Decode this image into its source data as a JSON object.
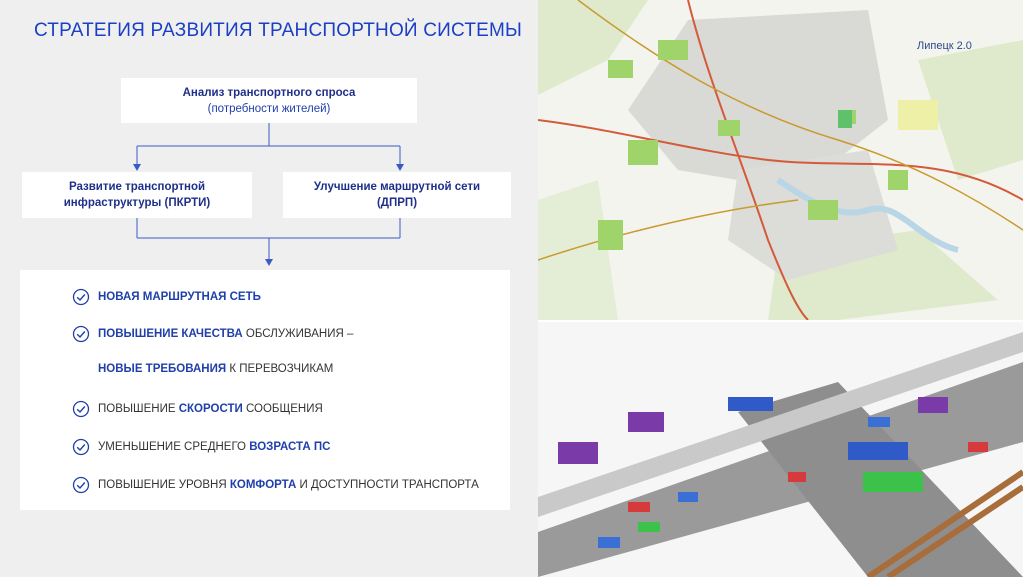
{
  "slide": {
    "title": "СТРАТЕГИЯ РАЗВИТИЯ ТРАНСПОРТНОЙ СИСТЕМЫ",
    "top_box": {
      "bold": "Анализ транспортного спроса",
      "sub": "(потребности жителей)"
    },
    "left_box": {
      "line1": "Развитие транспортной",
      "line2": "инфраструктуры (ПКРТИ)"
    },
    "right_box": {
      "line1": "Улучшение маршрутной сети",
      "line2": "(ДПРП)"
    },
    "items": [
      {
        "hl": "НОВАЯ МАРШРУТНАЯ СЕТЬ"
      },
      {
        "hl": "ПОВЫШЕНИЕ КАЧЕСТВА",
        "rest": " ОБСЛУЖИВАНИЯ –"
      },
      {
        "hl": "НОВЫЕ ТРЕБОВАНИЯ",
        "rest": " К ПЕРЕВОЗЧИКАМ"
      },
      {
        "pre": "ПОВЫШЕНИЕ ",
        "hl": "СКОРОСТИ",
        "rest": " СООБЩЕНИЯ"
      },
      {
        "pre": "УМЕНЬШЕНИЕ СРЕДНЕГО ",
        "hl": "ВОЗРАСТА ПС"
      },
      {
        "pre": "ПОВЫШЕНИЕ УРОВНЯ ",
        "hl": "КОМФОРТА",
        "rest": " И ДОСТУПНОСТИ ТРАНСПОРТА"
      }
    ],
    "map_label": "Липецк 2.0",
    "colors": {
      "accent": "#1a3fc4",
      "check": "#1f3faa",
      "connector": "#3a5bc7"
    },
    "icons": [
      "check-circle-icon",
      "arrow-down-icon"
    ]
  }
}
